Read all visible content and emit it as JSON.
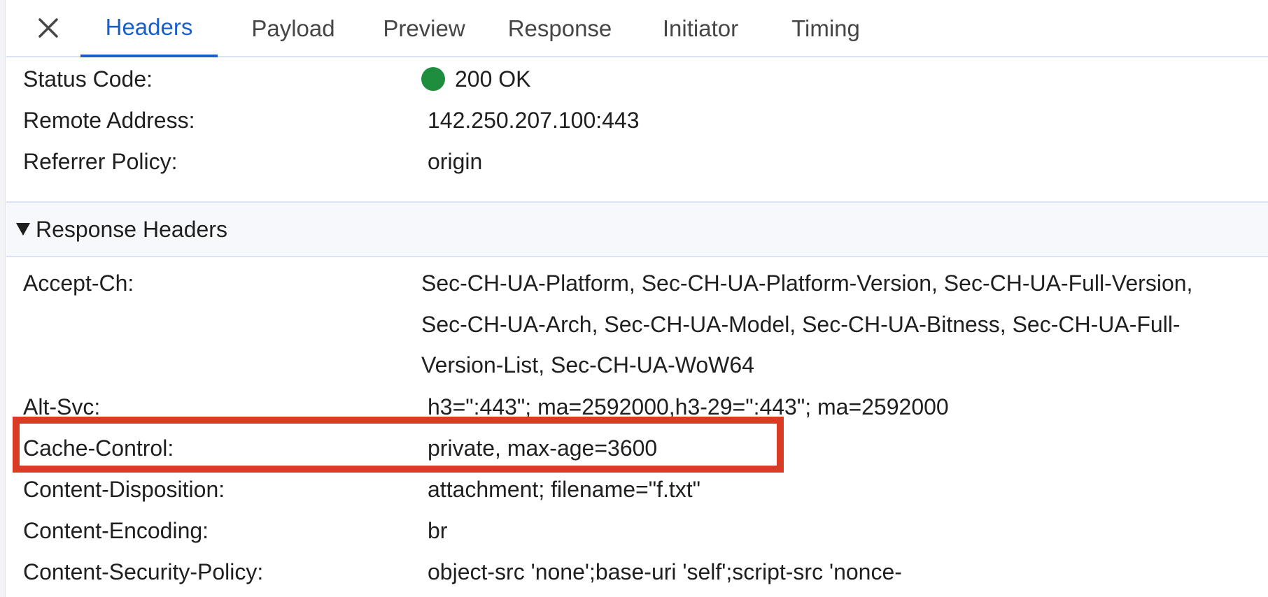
{
  "tabs": [
    {
      "label": "Headers",
      "active": true
    },
    {
      "label": "Payload",
      "active": false
    },
    {
      "label": "Preview",
      "active": false
    },
    {
      "label": "Response",
      "active": false
    },
    {
      "label": "Initiator",
      "active": false
    },
    {
      "label": "Timing",
      "active": false
    }
  ],
  "general": {
    "status_code_key": "Status Code:",
    "status_code_value": "200 OK",
    "remote_address_key": "Remote Address:",
    "remote_address_value": "142.250.207.100:443",
    "referrer_policy_key": "Referrer Policy:",
    "referrer_policy_value": "origin"
  },
  "response_headers": {
    "section_title": "Response Headers",
    "accept_ch_key": "Accept-Ch:",
    "accept_ch_value": "Sec-CH-UA-Platform, Sec-CH-UA-Platform-Version, Sec-CH-UA-Full-Version, Sec-CH-UA-Arch, Sec-CH-UA-Model, Sec-CH-UA-Bitness, Sec-CH-UA-Full-Version-List, Sec-CH-UA-WoW64",
    "alt_svc_key": "Alt-Svc:",
    "alt_svc_value": "h3=\":443\"; ma=2592000,h3-29=\":443\"; ma=2592000",
    "cache_control_key": "Cache-Control:",
    "cache_control_value": "private, max-age=3600",
    "content_disposition_key": "Content-Disposition:",
    "content_disposition_value": "attachment; filename=\"f.txt\"",
    "content_encoding_key": "Content-Encoding:",
    "content_encoding_value": "br",
    "csp_key": "Content-Security-Policy:",
    "csp_value": "object-src 'none';base-uri 'self';script-src 'nonce-"
  },
  "colors": {
    "accent": "#1a5fc9",
    "status_ok": "#1e8e3e",
    "highlight": "#d93b25"
  }
}
